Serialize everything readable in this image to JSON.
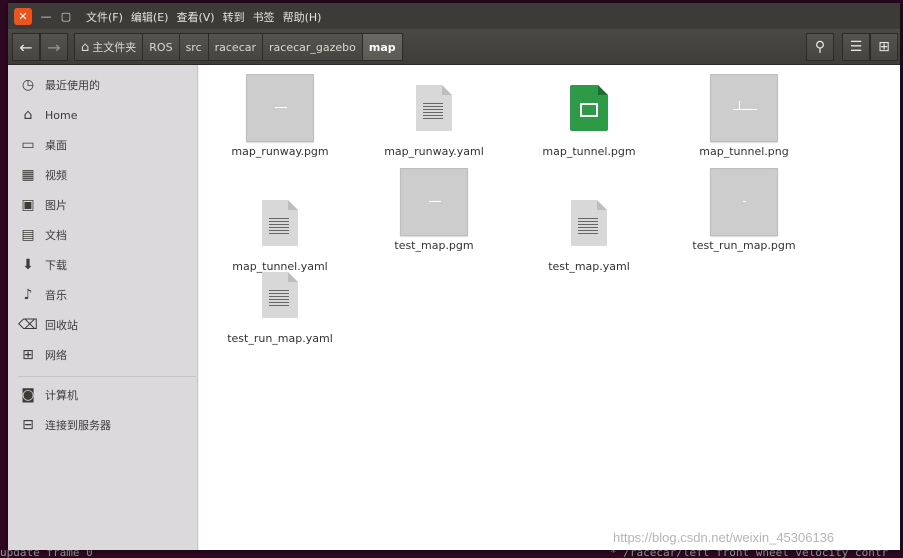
{
  "window": {
    "menu": [
      "文件(F)",
      "编辑(E)",
      "查看(V)",
      "转到",
      "书签",
      "帮助(H)"
    ]
  },
  "toolbar": {
    "breadcrumbs": [
      "主文件夹",
      "ROS",
      "src",
      "racecar",
      "racecar_gazebo",
      "map"
    ]
  },
  "sidebar": {
    "items": [
      {
        "label": "最近使用的",
        "icon": "clock-icon"
      },
      {
        "label": "Home",
        "icon": "home-icon"
      },
      {
        "label": "桌面",
        "icon": "desktop-icon"
      },
      {
        "label": "视频",
        "icon": "video-icon"
      },
      {
        "label": "图片",
        "icon": "picture-icon"
      },
      {
        "label": "文档",
        "icon": "document-icon"
      },
      {
        "label": "下载",
        "icon": "download-icon"
      },
      {
        "label": "音乐",
        "icon": "music-icon"
      },
      {
        "label": "回收站",
        "icon": "trash-icon"
      },
      {
        "label": "网络",
        "icon": "network-icon"
      }
    ],
    "devices": [
      {
        "label": "计算机",
        "icon": "computer-icon"
      },
      {
        "label": "连接到服务器",
        "icon": "server-icon"
      }
    ]
  },
  "files": [
    {
      "name": "map_runway.pgm",
      "kind": "pgm"
    },
    {
      "name": "map_runway.yaml",
      "kind": "yaml"
    },
    {
      "name": "map_tunnel.pgm",
      "kind": "image"
    },
    {
      "name": "map_tunnel.png",
      "kind": "png"
    },
    {
      "name": "map_tunnel.yaml",
      "kind": "yaml"
    },
    {
      "name": "test_map.pgm",
      "kind": "pgm"
    },
    {
      "name": "test_map.yaml",
      "kind": "yaml"
    },
    {
      "name": "test_run_map.pgm",
      "kind": "pgm"
    },
    {
      "name": "test_run_map.yaml",
      "kind": "yaml"
    }
  ],
  "terminal": {
    "bottom_left": "update_frame 0",
    "bottom_right": "* /racecar/left_front_wheel_velocity_contr"
  },
  "watermark": "https://blog.csdn.net/weixin_45306136"
}
